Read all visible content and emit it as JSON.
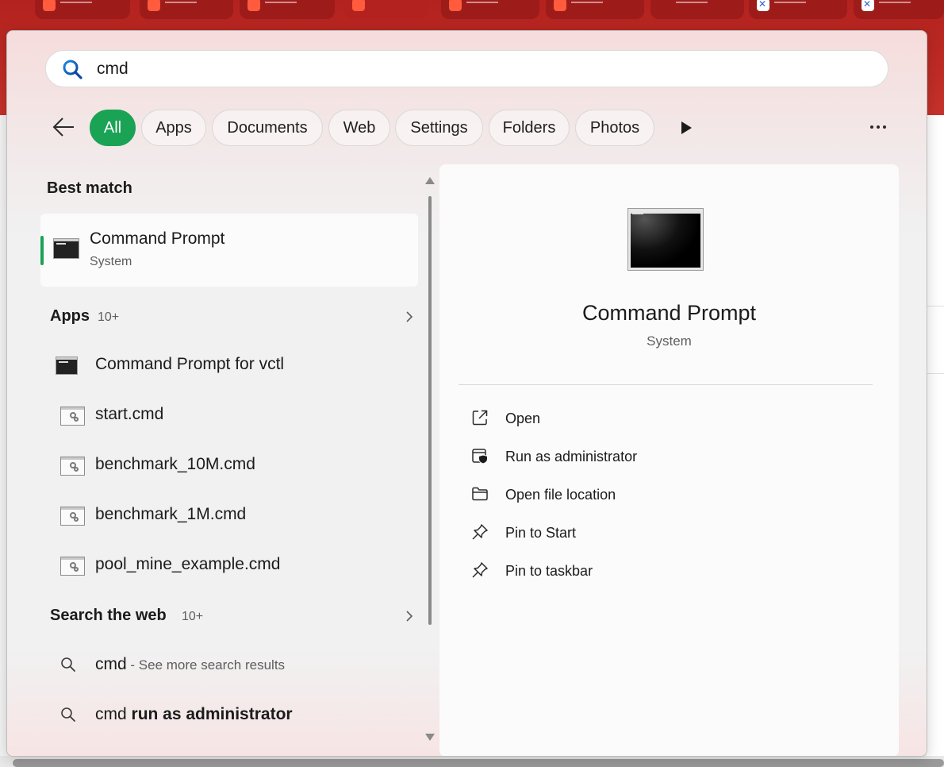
{
  "search": {
    "query": "cmd",
    "placeholder": ""
  },
  "filters": [
    "All",
    "Apps",
    "Documents",
    "Web",
    "Settings",
    "Folders",
    "Photos"
  ],
  "best_match": {
    "heading": "Best match",
    "title": "Command Prompt",
    "subtitle": "System"
  },
  "apps": {
    "heading": "Apps",
    "count": "10+",
    "items": [
      "Command Prompt for vctl",
      "start.cmd",
      "benchmark_10M.cmd",
      "benchmark_1M.cmd",
      "pool_mine_example.cmd"
    ]
  },
  "web": {
    "heading": "Search the web",
    "count": "10+",
    "items": [
      {
        "prefix": "cmd",
        "bold": "",
        "suffix": " - See more search results"
      },
      {
        "prefix": "cmd ",
        "bold": "run as administrator",
        "suffix": ""
      }
    ]
  },
  "preview": {
    "title": "Command Prompt",
    "subtitle": "System",
    "actions": [
      "Open",
      "Run as administrator",
      "Open file location",
      "Pin to Start",
      "Pin to taskbar"
    ]
  },
  "colors": {
    "accent": "#1aa355",
    "browser_red": "#c6322b"
  },
  "icons": {
    "search": "search-icon",
    "back": "back-arrow-icon",
    "more": "more-icon",
    "play": "play-icon",
    "app": "command-prompt-icon",
    "script": "batch-file-icon",
    "open": "open-external-icon",
    "admin": "shield-icon",
    "folder": "folder-icon",
    "pin": "pin-icon"
  }
}
